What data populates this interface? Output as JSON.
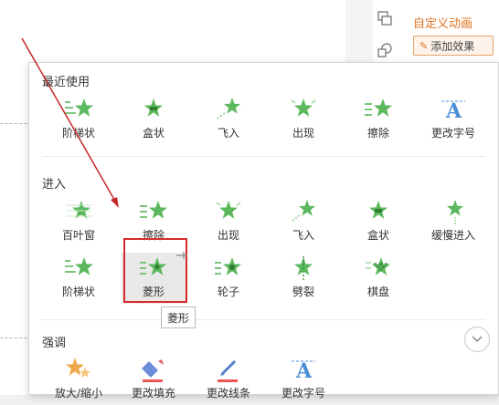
{
  "pane": {
    "title": "自定义动画",
    "add_effect_label": "添加效果"
  },
  "gallery": {
    "sections": {
      "recent": {
        "title": "最近使用",
        "items": [
          "阶梯状",
          "盒状",
          "飞入",
          "出现",
          "擦除",
          "更改字号"
        ]
      },
      "entrance": {
        "title": "进入",
        "row1": [
          "百叶窗",
          "擦除",
          "出现",
          "飞入",
          "盒状",
          "缓慢进入"
        ],
        "row2": [
          "阶梯状",
          "菱形",
          "轮子",
          "劈裂",
          "棋盘"
        ]
      },
      "emphasis": {
        "title": "强调",
        "items": [
          "放大/缩小",
          "更改填充",
          "更改线条",
          "更改字号"
        ]
      }
    },
    "tooltip": "菱形"
  },
  "colors": {
    "accent": "#e0731f",
    "star_green": "#5cb85c",
    "highlight_red": "#d62b2b",
    "annotation_arrow": "#c62828"
  }
}
